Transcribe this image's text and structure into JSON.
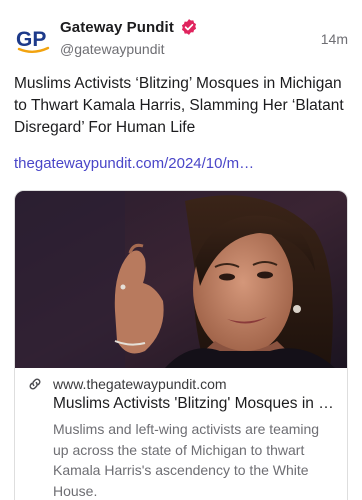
{
  "post": {
    "author": {
      "display_name": "Gateway Pundit",
      "handle": "@gatewaypundit",
      "avatar_text": "GP",
      "verified": true,
      "verified_color": "#e0245e"
    },
    "timestamp": "14m",
    "text": "Muslims Activists ‘Blitzing’ Mosques in Michigan to Thwart Kamala Harris, Slamming Her ‘Blatant Disregard’ For Human Life",
    "link": "thegatewaypundit.com/2024/10/m…",
    "link_color": "#4a46c8",
    "card": {
      "domain": "www.thegatewaypundit.com",
      "title": "Muslims Activists 'Blitzing' Mosques in Michigan to Thwart Kamala Harris, Slamming Her 'Blatant Disregard' For Human Life",
      "description": "Muslims and left-wing activists are teaming up across the state of Michigan to thwart Kamala Harris's ascendency to the White House.",
      "link_icon": "link-icon"
    }
  }
}
